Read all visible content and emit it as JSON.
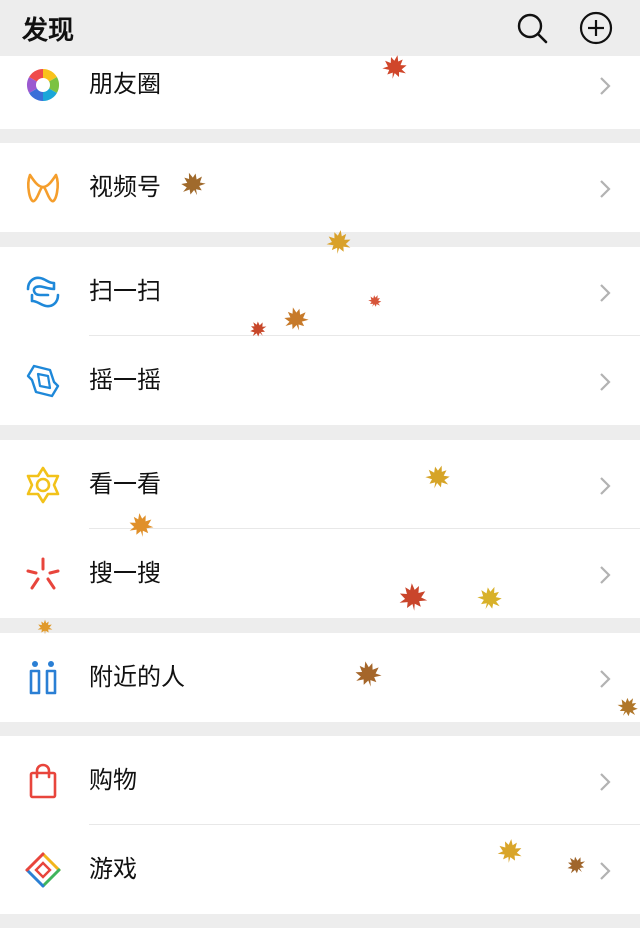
{
  "header": {
    "title": "发现",
    "search_icon": "search-icon",
    "add_icon": "plus-circle-icon"
  },
  "items": {
    "moments": {
      "label": "朋友圈",
      "icon": "aperture-icon"
    },
    "channels": {
      "label": "视频号",
      "icon": "channels-icon"
    },
    "scan": {
      "label": "扫一扫",
      "icon": "scan-icon"
    },
    "shake": {
      "label": "摇一摇",
      "icon": "shake-icon"
    },
    "top_stories": {
      "label": "看一看",
      "icon": "star-icon"
    },
    "search": {
      "label": "搜一搜",
      "icon": "search-spark-icon"
    },
    "nearby": {
      "label": "附近的人",
      "icon": "people-nearby-icon"
    },
    "shopping": {
      "label": "购物",
      "icon": "shopping-bag-icon"
    },
    "games": {
      "label": "游戏",
      "icon": "game-diamond-icon"
    }
  },
  "colors": {
    "background": "#ededed",
    "card": "#ffffff",
    "channels": "#f59e2c",
    "scan": "#1e88d9",
    "star": "#f2c21a",
    "search": "#e8453c",
    "nearby": "#2a7fd4",
    "shopping": "#e8453c"
  },
  "decoration": "falling-maple-leaves"
}
